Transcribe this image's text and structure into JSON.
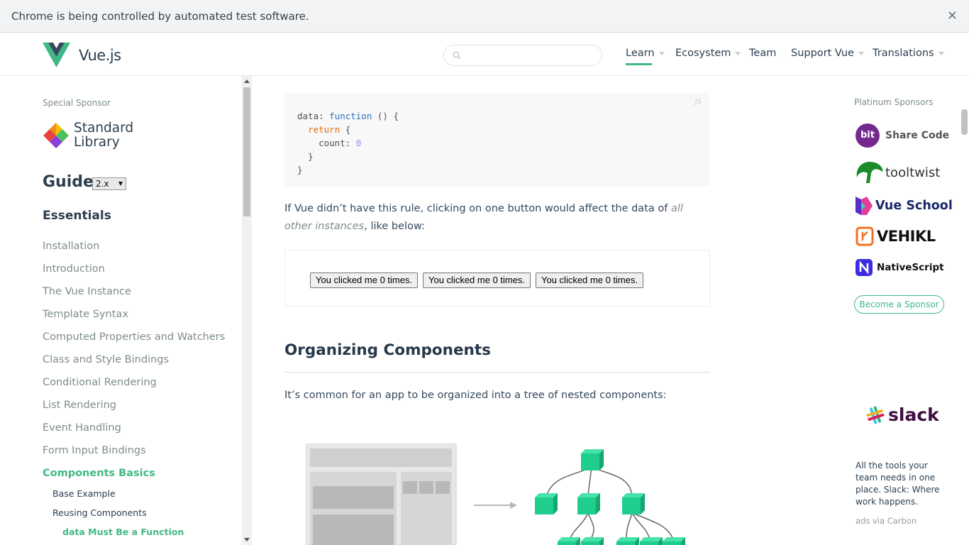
{
  "infobar": {
    "message": "Chrome is being controlled by automated test software.",
    "close": "×"
  },
  "header": {
    "logo_text": "Vue.js",
    "search_placeholder": "",
    "nav": [
      {
        "label": "Learn"
      },
      {
        "label": "Ecosystem"
      },
      {
        "label": "Team"
      },
      {
        "label": "Support Vue"
      },
      {
        "label": "Translations"
      }
    ]
  },
  "sidebar": {
    "special_sponsor_label": "Special Sponsor",
    "sponsor_line1": "Standard",
    "sponsor_line2": "Library",
    "guide_title": "Guide",
    "version": "2.x",
    "section": "Essentials",
    "items": [
      "Installation",
      "Introduction",
      "The Vue Instance",
      "Template Syntax",
      "Computed Properties and Watchers",
      "Class and Style Bindings",
      "Conditional Rendering",
      "List Rendering",
      "Event Handling",
      "Form Input Bindings",
      "Components Basics"
    ],
    "sub_items": [
      "Base Example",
      "Reusing Components",
      "data Must Be a Function"
    ]
  },
  "main": {
    "code_lang": "JS",
    "code": {
      "l1_prop": "data: ",
      "l1_fn": "function",
      "l1_rest": " () {",
      "l2_ret": "return",
      "l2_rest": " {",
      "l3_prop": "count: ",
      "l3_num": "0",
      "l4": "}",
      "l5": "}"
    },
    "para1_a": "If Vue didn’t have this rule, clicking on one button would affect the data of ",
    "para1_em": "all other instances",
    "para1_b": ", like below:",
    "demo_buttons": [
      "You clicked me 0 times.",
      "You clicked me 0 times.",
      "You clicked me 0 times."
    ],
    "section_title": "Organizing Components",
    "para2": "It’s common for an app to be organized into a tree of nested components:"
  },
  "right": {
    "platinum_label": "Platinum Sponsors",
    "sponsors": [
      {
        "badge": "bit",
        "name": "Share Code"
      },
      {
        "name": "tooltwist"
      },
      {
        "name": "Vue School"
      },
      {
        "name": "VEHIKL"
      },
      {
        "name": "NativeScript"
      }
    ],
    "become_sponsor": "Become a Sponsor",
    "ad_logo": "slack",
    "ad_text": "All the tools your team needs in one place. Slack: Where work happens.",
    "ad_via": "ads via Carbon"
  },
  "colors": {
    "accent": "#42b983",
    "text": "#2c3e50",
    "muted": "#7f8c8d"
  }
}
